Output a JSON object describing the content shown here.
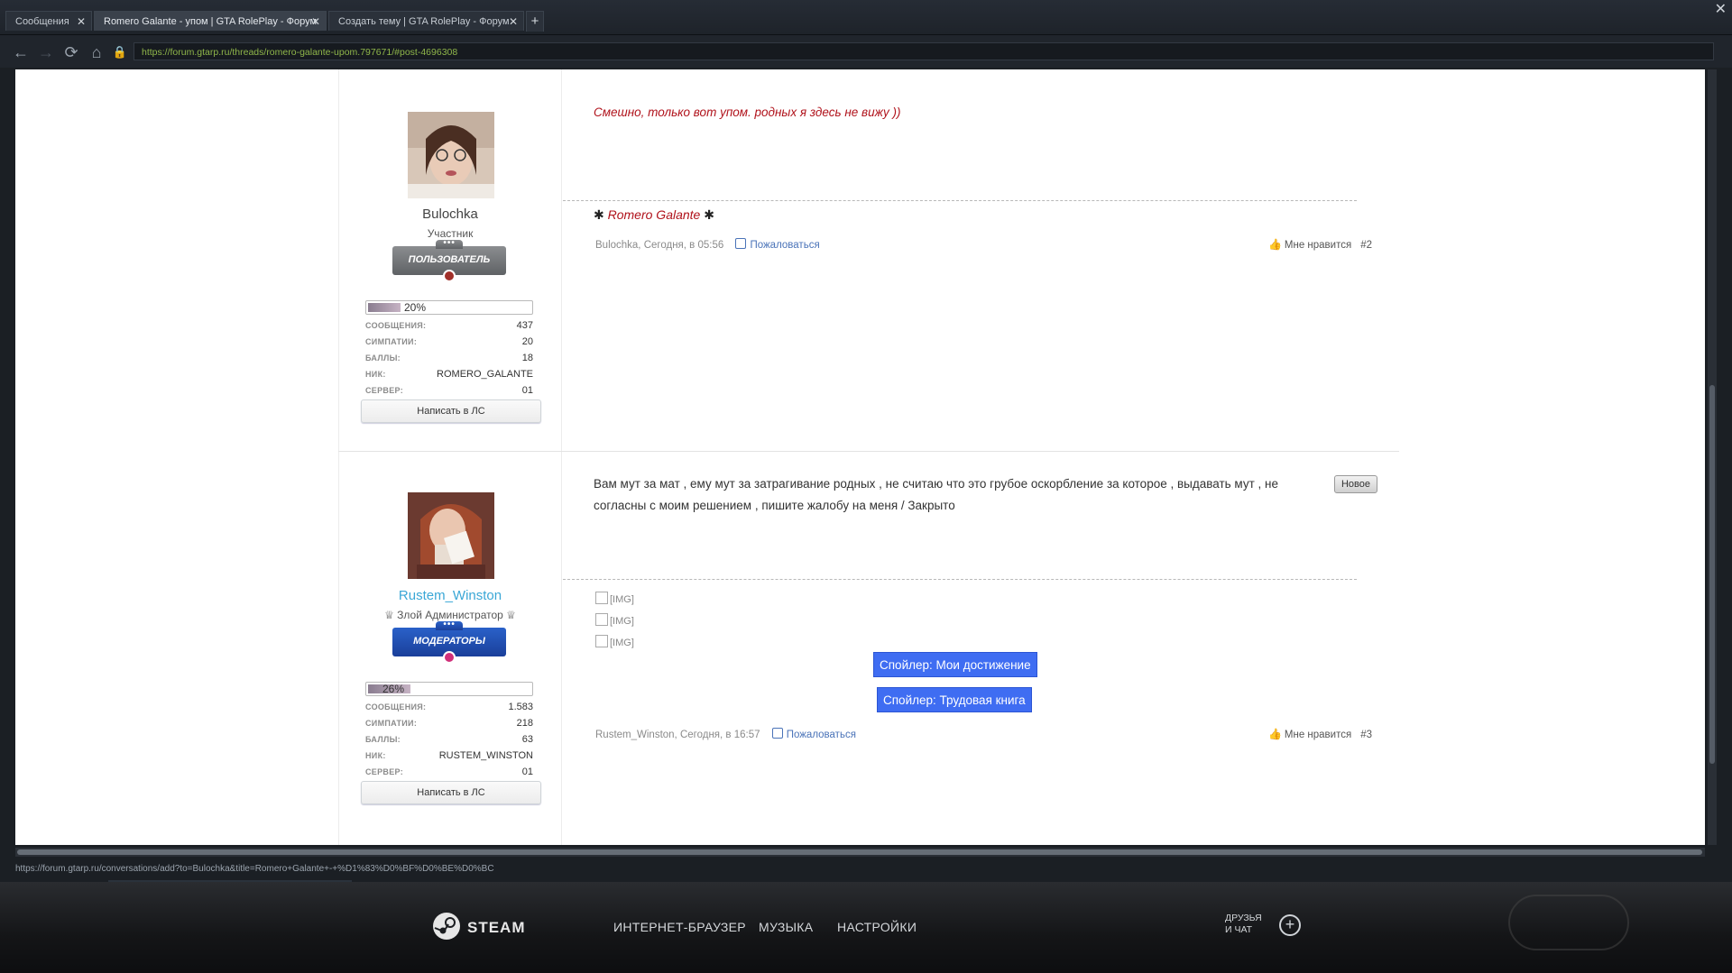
{
  "tabs": [
    {
      "label": "Сообщения",
      "close": "✕"
    },
    {
      "label": "Romero Galante - упом | GTA RolePlay - Форум",
      "close": "✕"
    },
    {
      "label": "Создать тему | GTA RolePlay - Форум",
      "close": "✕"
    }
  ],
  "new_tab": "+",
  "window_close": "✕",
  "nav": {
    "back": "←",
    "forward": "→",
    "reload": "⟳",
    "home": "⌂",
    "lock": "🔒",
    "url": "https://forum.gtarp.ru/threads/romero-galante-upom.797671/#post-4696308"
  },
  "status_url": "https://forum.gtarp.ru/conversations/add?to=Bulochka&title=Romero+Galante+-+%D1%83%D0%BF%D0%BE%D0%BC",
  "posts": [
    {
      "user": {
        "name": "Bulochka",
        "title": "Участник",
        "badge": "ПОЛЬЗОВАТЕЛЬ",
        "badge_dots": "•••",
        "progress_text": "20%",
        "progress_value": 0.2,
        "stats": [
          {
            "key": "СООБЩЕНИЯ:",
            "value": "437"
          },
          {
            "key": "СИМПАТИИ:",
            "value": "20"
          },
          {
            "key": "БАЛЛЫ:",
            "value": "18"
          },
          {
            "key": "НИК:",
            "value": "ROMERO_GALANTE"
          },
          {
            "key": "СЕРВЕР:",
            "value": "01"
          }
        ],
        "pm_label": "Написать в ЛС"
      },
      "message": "Смешно, только вот упом. родных я здесь не вижу ))",
      "signature": {
        "star_left": "✱",
        "text": "Romero Galante",
        "star_right": "✱"
      },
      "meta": {
        "author_time": "Bulochka, Сегодня, в 05:56",
        "report": "Пожаловаться"
      },
      "like": {
        "icon": "👍",
        "label": "Мне нравится",
        "number": "#2"
      }
    },
    {
      "user": {
        "name": "Rustem_Winston",
        "title": "♕ Злой Администратор ♕",
        "badge": "МОДЕРАТОРЫ",
        "badge_dots": "•••",
        "progress_text": "26%",
        "progress_value": 0.26,
        "stats": [
          {
            "key": "СООБЩЕНИЯ:",
            "value": "1.583"
          },
          {
            "key": "СИМПАТИИ:",
            "value": "218"
          },
          {
            "key": "БАЛЛЫ:",
            "value": "63"
          },
          {
            "key": "НИК:",
            "value": "RUSTEM_WINSTON"
          },
          {
            "key": "СЕРВЕР:",
            "value": "01"
          }
        ],
        "pm_label": "Написать в ЛС"
      },
      "new_tag": "Новое",
      "message": "Вам мут за мат , ему мут за затрагивание родных , не считаю что это грубое оскорбление за которое , выдавать мут , не согласны с моим решением , пишите жалобу на меня / Закрыто",
      "images": [
        "[IMG]",
        "[IMG]",
        "[IMG]"
      ],
      "spoilers": [
        "Спойлер: Мои достижение",
        "Спойлер: Трудовая книга"
      ],
      "meta": {
        "author_time": "Rustem_Winston, Сегодня, в 16:57",
        "report": "Пожаловаться"
      },
      "like": {
        "icon": "👍",
        "label": "Мне нравится",
        "number": "#3"
      }
    }
  ],
  "steam": {
    "logo": "STEAM",
    "nav": [
      "ИНТЕРНЕТ-БРАУЗЕР",
      "МУЗЫКА",
      "НАСТРОЙКИ"
    ],
    "friends_line1": "ДРУЗЬЯ",
    "friends_line2": "И ЧАТ",
    "friends_plus": "+"
  },
  "colors": {
    "username_admin": "#3aa7d6",
    "quote_red": "#b0121b",
    "spoiler_blue": "#3f6df2",
    "url_green": "#8fb64a"
  }
}
